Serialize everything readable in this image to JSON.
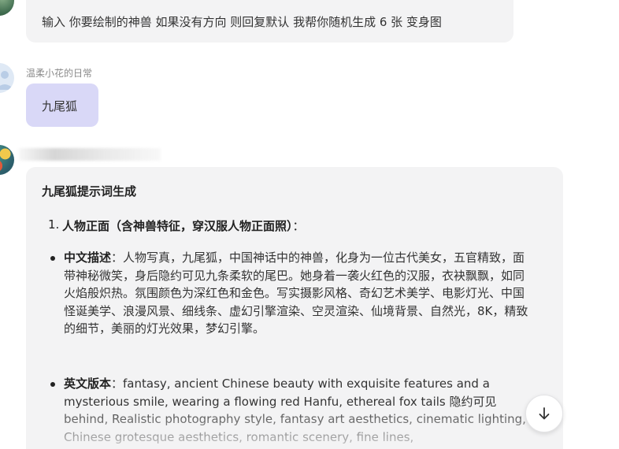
{
  "messages": {
    "prompt_text": "输入 你要绘制的神兽 如果没有方向 则回复默认 我帮你随机生成 6 张 变身图",
    "user_name": "温柔小花的日常",
    "user_message": "九尾狐",
    "bot": {
      "heading": "九尾狐提示词生成",
      "section_1": {
        "number": "1.",
        "title": "人物正面（含神兽特征，穿汉服人物正面照）",
        "suffix": "：",
        "items": [
          {
            "key": "中文描述",
            "sep": "：",
            "text": "人物写真，九尾狐，中国神话中的神兽，化身为一位古代美女，五官精致，面带神秘微笑，身后隐约可见九条柔软的尾巴。她身着一袭火红色的汉服，衣袂飘飘，如同火焰般炽热。氛围颜色为深红色和金色。写实摄影风格、奇幻艺术美学、电影灯光、中国怪诞美学、浪漫风景、细线条、虚幻引擎渲染、空灵渲染、仙境背景、自然光，8K，精致的细节，美丽的灯光效果，梦幻引擎。"
          },
          {
            "key": "英文版本",
            "sep": "：",
            "text": "fantasy, ancient Chinese beauty with exquisite features and a mysterious smile, wearing a flowing red Hanfu, ethereal fox tails 隐约可见 behind, Realistic photography style, fantasy art aesthetics, cinematic lighting, Chinese grotesque aesthetics, romantic scenery, fine lines,"
          }
        ]
      }
    }
  },
  "scroll_button": {
    "icon": "arrow-down-icon"
  }
}
